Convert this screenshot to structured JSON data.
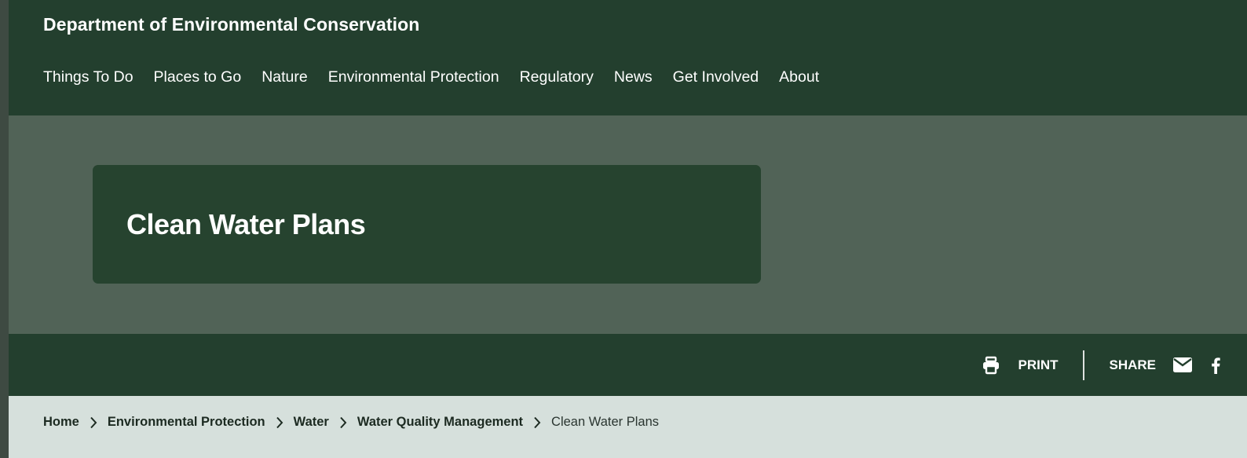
{
  "header": {
    "agency_name": "Department of Environmental Conservation",
    "nav": [
      {
        "label": "Things To Do"
      },
      {
        "label": "Places to Go"
      },
      {
        "label": "Nature"
      },
      {
        "label": "Environmental Protection"
      },
      {
        "label": "Regulatory"
      },
      {
        "label": "News"
      },
      {
        "label": "Get Involved"
      },
      {
        "label": "About"
      }
    ]
  },
  "hero": {
    "title": "Clean Water Plans"
  },
  "utility": {
    "print_label": "PRINT",
    "print_icon": "printer-icon",
    "share_label": "SHARE",
    "share_icons": [
      "email-icon",
      "facebook-icon"
    ]
  },
  "breadcrumb": {
    "items": [
      {
        "label": "Home"
      },
      {
        "label": "Environmental Protection"
      },
      {
        "label": "Water"
      },
      {
        "label": "Water Quality Management"
      }
    ],
    "current": "Clean Water Plans"
  },
  "colors": {
    "header_bg": "#233f2e",
    "hero_bg": "#516357",
    "card_bg": "#26432f",
    "breadcrumb_bg": "#d6e0dc"
  }
}
